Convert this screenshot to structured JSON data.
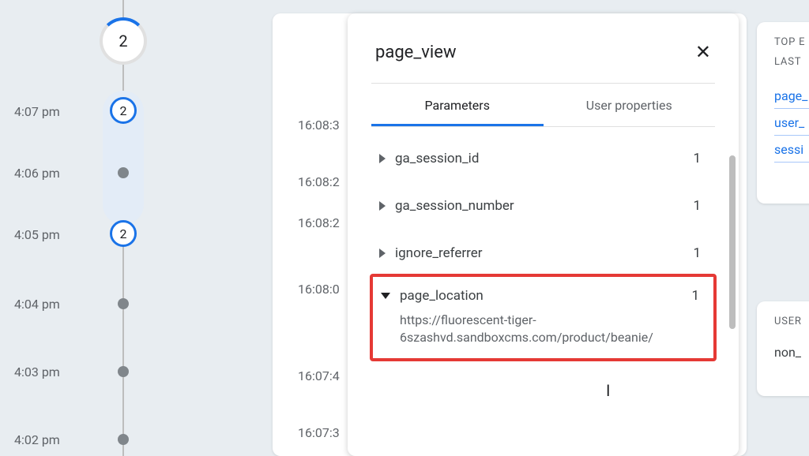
{
  "timeline": {
    "big_node_value": "2",
    "nodes": [
      {
        "time": "4:07 pm",
        "value": "2",
        "type": "med"
      },
      {
        "time": "4:06 pm",
        "value": "",
        "type": "dot"
      },
      {
        "time": "4:05 pm",
        "value": "2",
        "type": "med"
      },
      {
        "time": "4:04 pm",
        "value": "",
        "type": "dot"
      },
      {
        "time": "4:03 pm",
        "value": "",
        "type": "dot"
      },
      {
        "time": "4:02 pm",
        "value": "",
        "type": "dot"
      }
    ]
  },
  "bg_timestamps": [
    "16:08:3",
    "16:08:2",
    "16:08:2",
    "16:08:0",
    "16:07:4",
    "16:07:3"
  ],
  "detail": {
    "title": "page_view",
    "tabs": {
      "parameters": "Parameters",
      "user_properties": "User properties"
    },
    "params": [
      {
        "name": "ga_session_id",
        "count": "1",
        "expanded": false
      },
      {
        "name": "ga_session_number",
        "count": "1",
        "expanded": false
      },
      {
        "name": "ignore_referrer",
        "count": "1",
        "expanded": false
      },
      {
        "name": "page_location",
        "count": "1",
        "expanded": true,
        "value": "https://fluorescent-tiger-6szashvd.sandboxcms.com/product/beanie/"
      }
    ]
  },
  "right1": {
    "hdr1": "TOP E",
    "hdr2": "LAST",
    "rows": [
      "page_",
      "user_",
      "sessi"
    ]
  },
  "right2": {
    "hdr": "USER",
    "rows": [
      "non_"
    ]
  }
}
